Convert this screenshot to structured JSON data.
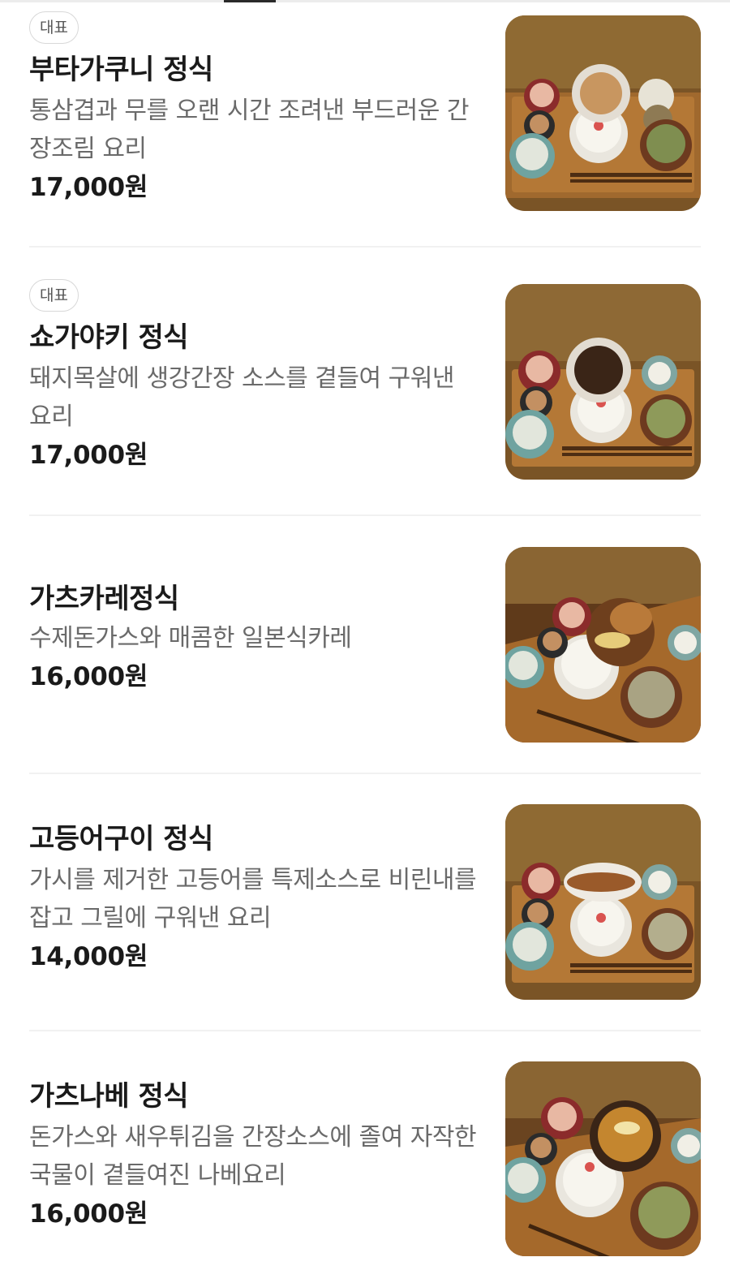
{
  "menu": {
    "items": [
      {
        "badge": "대표",
        "name": "부타가쿠니 정식",
        "description": "통삼겹과 무를 오랜 시간 조려낸 부드러운 간장조림 요리",
        "price": "17,000원",
        "image": "set-meal-photo"
      },
      {
        "badge": "대표",
        "name": "쇼가야키 정식",
        "description": "돼지목살에 생강간장 소스를 곁들여 구워낸 요리",
        "price": "17,000원",
        "image": "set-meal-photo"
      },
      {
        "name": "가츠카레정식",
        "description": "수제돈가스와 매콤한 일본식카레",
        "price": "16,000원",
        "image": "set-meal-photo"
      },
      {
        "name": "고등어구이 정식",
        "description": "가시를 제거한 고등어를 특제소스로 비린내를 잡고 그릴에 구워낸 요리",
        "price": "14,000원",
        "image": "set-meal-photo"
      },
      {
        "name": "가츠나베 정식",
        "description": "돈가스와 새우튀김을 간장소스에 졸여 자작한 국물이 곁들여진 나베요리",
        "price": "16,000원",
        "image": "set-meal-photo"
      }
    ]
  }
}
